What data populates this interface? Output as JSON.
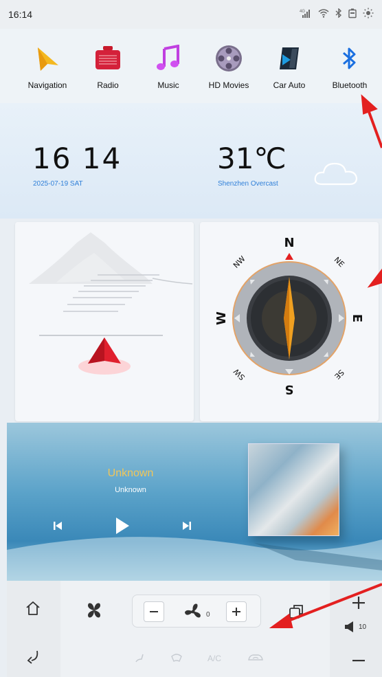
{
  "status_bar": {
    "time": "16:14",
    "icons": [
      "signal-icon",
      "wifi-icon",
      "bluetooth-icon",
      "battery-icon",
      "brightness-icon"
    ],
    "signal_label": "4G"
  },
  "apps": [
    {
      "label": "Navigation",
      "icon": "navigation-arrow-icon"
    },
    {
      "label": "Radio",
      "icon": "radio-icon"
    },
    {
      "label": "Music",
      "icon": "music-note-icon"
    },
    {
      "label": "HD Movies",
      "icon": "film-reel-icon"
    },
    {
      "label": "Car Auto",
      "icon": "car-auto-icon"
    },
    {
      "label": "Bluetooth",
      "icon": "bluetooth-icon"
    }
  ],
  "clock": {
    "time": "16 14",
    "date": "2025-07-19  SAT"
  },
  "weather": {
    "temperature": "31℃",
    "city_condition": "Shenzhen  Overcast",
    "icon": "cloud-icon"
  },
  "compass": {
    "labels": {
      "n": "N",
      "ne": "NE",
      "e": "E",
      "se": "SE",
      "s": "S",
      "sw": "SW",
      "w": "W",
      "nw": "NW"
    }
  },
  "music": {
    "title": "Unknown",
    "artist": "Unknown"
  },
  "climate": {
    "fan_level": "0",
    "ac_label": "A/C"
  },
  "volume": {
    "level": "10"
  },
  "colors": {
    "accent_blue": "#2f7fd8",
    "music_title": "#f0c65a",
    "annotation_red": "#e32020"
  }
}
